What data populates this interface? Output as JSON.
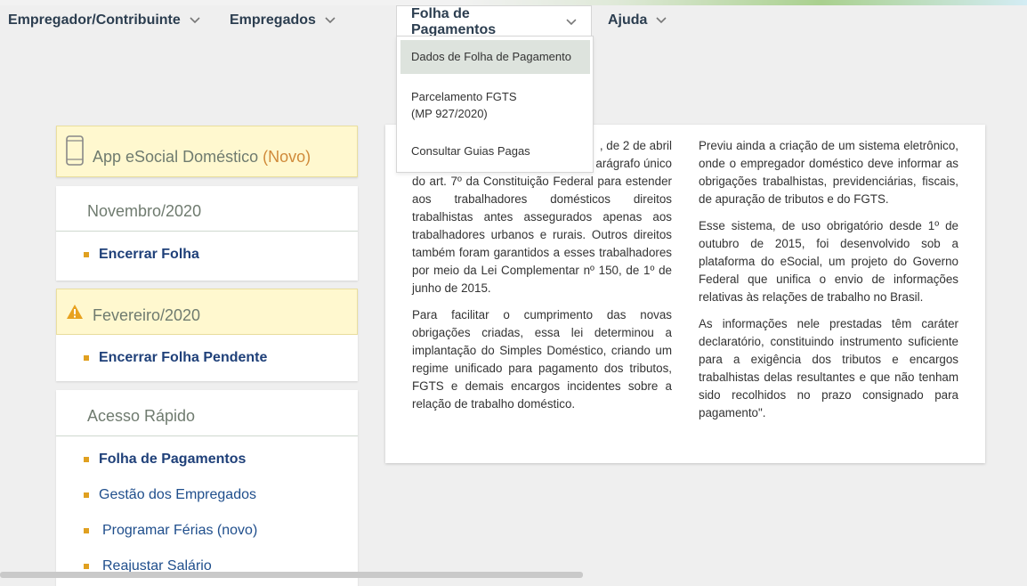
{
  "nav": {
    "items": [
      {
        "label": "Empregador/Contribuinte"
      },
      {
        "label": "Empregados"
      },
      {
        "label": "Folha de Pagamentos"
      },
      {
        "label": "Ajuda"
      }
    ],
    "dropdown": [
      {
        "label": "Dados de Folha de Pagamento"
      },
      {
        "label_line1": "Parcelamento FGTS",
        "label_line2": "(MP 927/2020)"
      },
      {
        "label": "Consultar Guias Pagas"
      }
    ]
  },
  "sidebar": {
    "app_card": {
      "title": "App eSocial Doméstico",
      "badge": "(Novo)",
      "icon": "phone-icon"
    },
    "month_card": {
      "title": "Novembro/2020",
      "link": "Encerrar Folha"
    },
    "pending_card": {
      "title": "Fevereiro/2020",
      "icon": "warning-icon",
      "link": "Encerrar Folha Pendente"
    },
    "quick_access": {
      "title": "Acesso Rápido",
      "links": [
        "Folha de Pagamentos",
        "Gestão dos Empregados",
        "Programar Férias (novo)",
        "Reajustar Salário"
      ]
    }
  },
  "content": {
    "left_paragraphs": [
      ", de 2 de abril",
      "arágrafo único",
      "do art. 7º da Constituição Federal para estender aos trabalhadores domésticos direitos trabalhistas antes assegurados apenas aos trabalhadores urbanos e rurais. Outros direitos também foram garantidos a esses trabalhadores por meio da Lei Complementar nº 150, de 1º de junho de 2015.",
      "Para facilitar o cumprimento das novas obrigações criadas, essa lei determinou a implantação do Simples Doméstico, criando um regime unificado para pagamento dos tributos, FGTS e demais encargos incidentes sobre a relação de trabalho doméstico."
    ],
    "right_paragraphs": [
      "Previu ainda a criação de um sistema eletrônico, onde o empregador doméstico deve informar as obrigações trabalhistas, previdenciárias, fiscais, de apuração de tributos e do FGTS.",
      "Esse sistema, de uso obrigatório desde 1º de outubro de 2015, foi desenvolvido sob a plataforma do eSocial, um projeto do Governo Federal que unifica o envio de informações relativas às relações de trabalho no Brasil.",
      "As informações nele prestadas têm caráter declaratório, constituindo instrumento suficiente para a exigência dos tributos e encargos trabalhistas delas resultantes e que não tenham sido recolhidos no prazo consignado para pagamento\"."
    ]
  },
  "colors": {
    "accent_bullet": "#e0a020",
    "link": "#1f4e8c",
    "badge": "#d08a3a",
    "alert_bg": "#fff8cf"
  }
}
